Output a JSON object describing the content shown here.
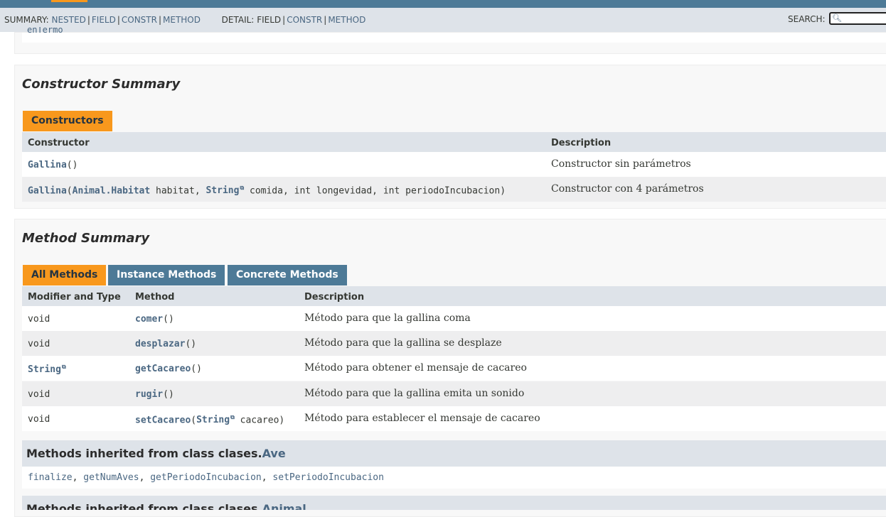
{
  "subnav": {
    "summary_label": "SUMMARY:",
    "summary_links": [
      "NESTED",
      "FIELD",
      "CONSTR",
      "METHOD"
    ],
    "detail_label": "DETAIL:",
    "detail_plain": "FIELD",
    "detail_links": [
      "CONSTR",
      "METHOD"
    ],
    "search_label": "SEARCH:",
    "search_value": "",
    "separator": "|"
  },
  "stub": {
    "code_text": "enTermo"
  },
  "constructor_summary": {
    "title": "Constructor Summary",
    "tab": "Constructors",
    "headers": {
      "constructor": "Constructor",
      "description": "Description"
    },
    "rows": [
      {
        "name": "Gallina",
        "open": "(",
        "close": ")",
        "description": "Constructor sin parámetros"
      },
      {
        "name": "Gallina",
        "open": "(",
        "param1_type": "Animal.Habitat",
        "param1_rest": " habitat, ",
        "param2_type": "String",
        "param2_rest": " comida, int longevidad, int periodoIncubacion)",
        "description": "Constructor con 4 parámetros"
      }
    ]
  },
  "method_summary": {
    "title": "Method Summary",
    "tabs": [
      "All Methods",
      "Instance Methods",
      "Concrete Methods"
    ],
    "headers": {
      "modifier": "Modifier and Type",
      "method": "Method",
      "description": "Description"
    },
    "rows": [
      {
        "type": "void",
        "name": "comer",
        "params": "()",
        "description": "Método para que la gallina coma"
      },
      {
        "type": "void",
        "name": "desplazar",
        "params": "()",
        "description": "Método para que la gallina se desplaze"
      },
      {
        "type": "String",
        "name": "getCacareo",
        "params": "()",
        "description": "Método para obtener el mensaje de cacareo"
      },
      {
        "type": "void",
        "name": "rugir",
        "params": "()",
        "description": "Método para que la gallina emita un sonido"
      },
      {
        "type": "void",
        "name": "setCacareo",
        "param_open": "(",
        "param_type": "String",
        "param_rest": " cacareo)",
        "description": "Método para establecer el mensaje de cacareo"
      }
    ]
  },
  "inherited": [
    {
      "prefix": "Methods inherited from class clases.",
      "class_link": "Ave",
      "methods": [
        "finalize",
        "getNumAves",
        "getPeriodoIncubacion",
        "setPeriodoIncubacion"
      ]
    },
    {
      "prefix": "Methods inherited from class clases.",
      "class_link": "Animal"
    }
  ],
  "colors": {
    "nav": "#4d7a97",
    "accent": "#f8981d",
    "header_bg": "#dee3e9",
    "link": "#4a6782"
  }
}
